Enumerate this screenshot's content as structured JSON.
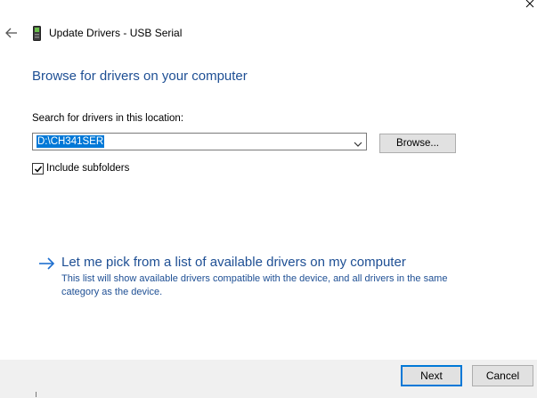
{
  "window": {
    "title": "Update Drivers - USB Serial",
    "icons": {
      "back": "back-arrow-icon",
      "device": "usb-device-icon",
      "close": "close-icon"
    }
  },
  "main": {
    "heading": "Browse for drivers on your computer",
    "search_label": "Search for drivers in this location:",
    "path_value": "D:\\CH341SER",
    "browse_label": "Browse...",
    "include_subfolders": {
      "label": "Include subfolders",
      "checked": true
    },
    "pick": {
      "link": "Let me pick from a list of available drivers on my computer",
      "description": "This list will show available drivers compatible with the device, and all drivers in the same category as the device."
    }
  },
  "footer": {
    "next_label": "Next",
    "cancel_label": "Cancel"
  },
  "colors": {
    "accent": "#0078d7",
    "heading": "#1e4f94",
    "footer_bg": "#f0f0f0"
  }
}
